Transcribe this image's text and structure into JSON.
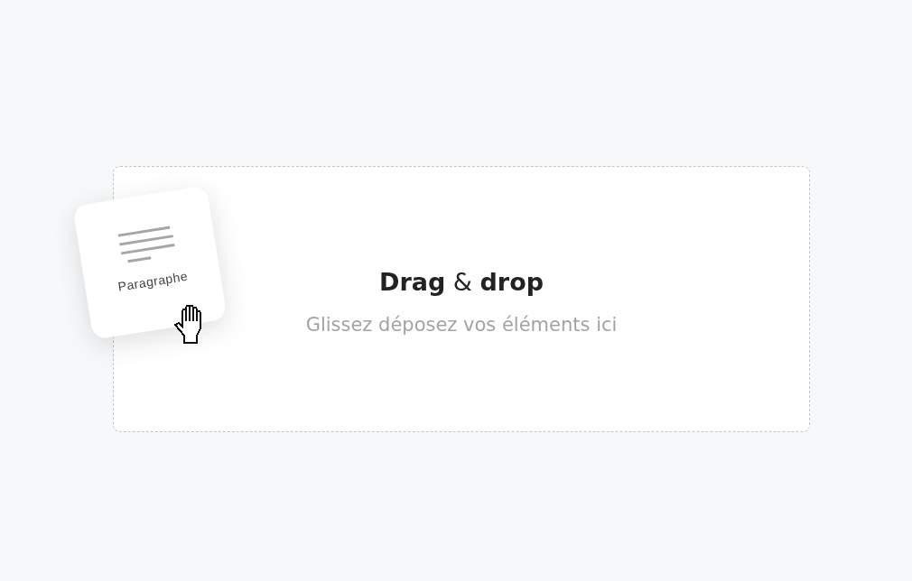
{
  "drop_zone": {
    "title": "**Drag** & **drop**",
    "subtitle": "Glissez déposez vos éléments ici"
  },
  "dragged_card": {
    "label": "Paragraphe"
  }
}
